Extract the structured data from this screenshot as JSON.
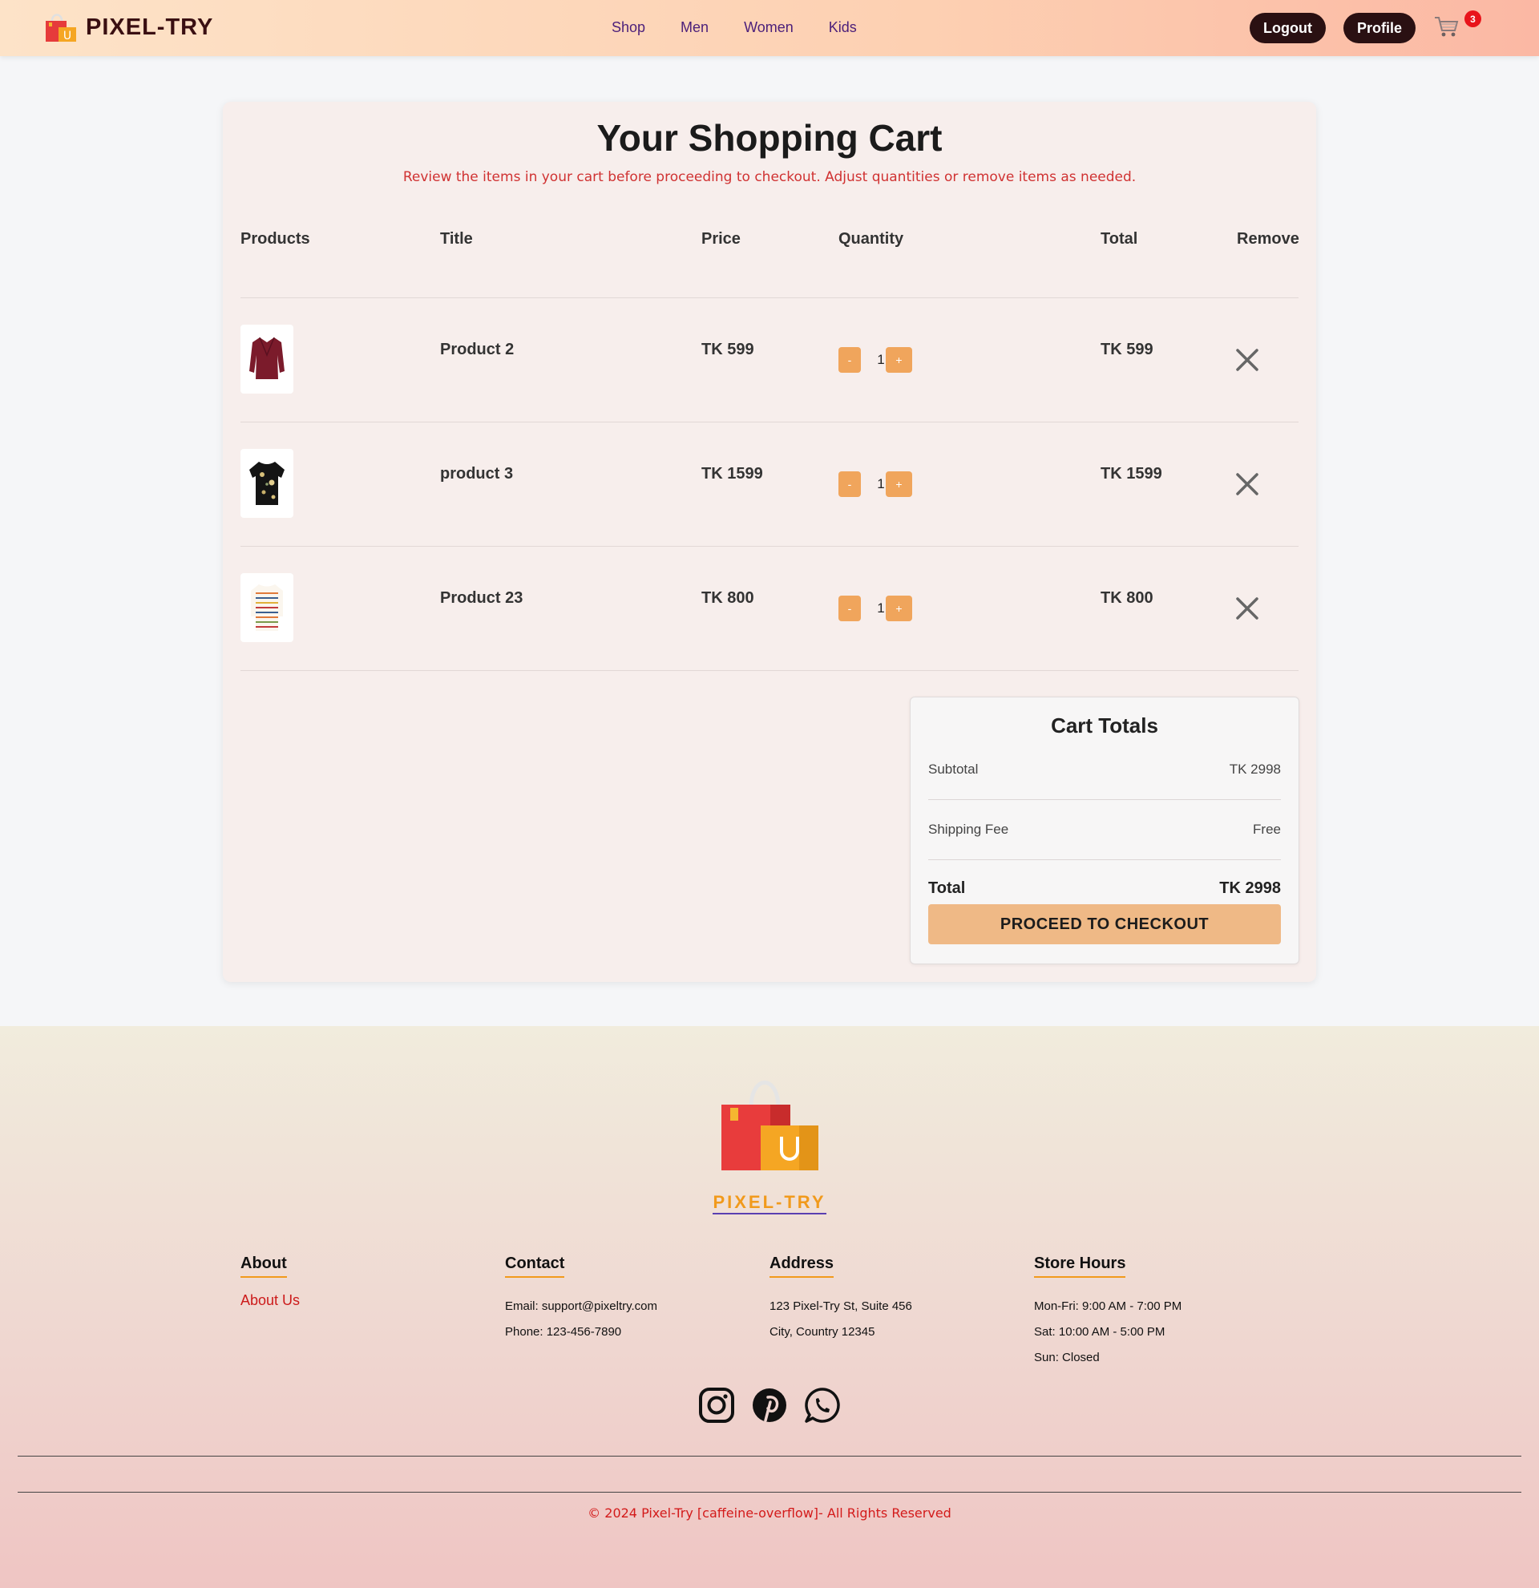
{
  "header": {
    "brand": "PIXEL-TRY",
    "nav": [
      "Shop",
      "Men",
      "Women",
      "Kids"
    ],
    "logout_label": "Logout",
    "profile_label": "Profile",
    "cart_count": "3"
  },
  "cart": {
    "title": "Your Shopping Cart",
    "subtitle": "Review the items in your cart before proceeding to checkout. Adjust quantities or remove items as needed.",
    "columns": [
      "Products",
      "Title",
      "Price",
      "Quantity",
      "Total",
      "Remove"
    ],
    "items": [
      {
        "title": "Product 2",
        "price": "TK 599",
        "quantity": "1",
        "total": "TK 599",
        "image": "burgundy-blouse"
      },
      {
        "title": "product 3",
        "price": "TK 1599",
        "quantity": "1",
        "total": "TK 1599",
        "image": "black-floral-top"
      },
      {
        "title": "Product 23",
        "price": "TK 800",
        "quantity": "1",
        "total": "TK 800",
        "image": "striped-sweater"
      }
    ],
    "decrement_label": "-",
    "increment_label": "+"
  },
  "totals": {
    "title": "Cart Totals",
    "subtotal_label": "Subtotal",
    "subtotal_value": "TK 2998",
    "shipping_label": "Shipping Fee",
    "shipping_value": "Free",
    "total_label": "Total",
    "total_value": "TK 2998",
    "checkout_label": "PROCEED TO CHECKOUT"
  },
  "footer": {
    "brand": "PIXEL-TRY",
    "about": {
      "heading": "About",
      "link": "About Us"
    },
    "contact": {
      "heading": "Contact",
      "email": "Email: support@pixeltry.com",
      "phone": "Phone: 123-456-7890"
    },
    "address": {
      "heading": "Address",
      "line1": "123 Pixel-Try St, Suite 456",
      "line2": "City, Country 12345"
    },
    "hours": {
      "heading": "Store Hours",
      "line1": "Mon-Fri: 9:00 AM - 7:00 PM",
      "line2": "Sat: 10:00 AM - 5:00 PM",
      "line3": "Sun: Closed"
    },
    "social": [
      "instagram-icon",
      "pinterest-icon",
      "whatsapp-icon"
    ],
    "copyright": "© 2024 Pixel-Try [caffeine-overflow]- All Rights Reserved"
  },
  "colors": {
    "accent": "#f0a55c",
    "dark": "#2a1012",
    "link": "#cc1a1a"
  }
}
